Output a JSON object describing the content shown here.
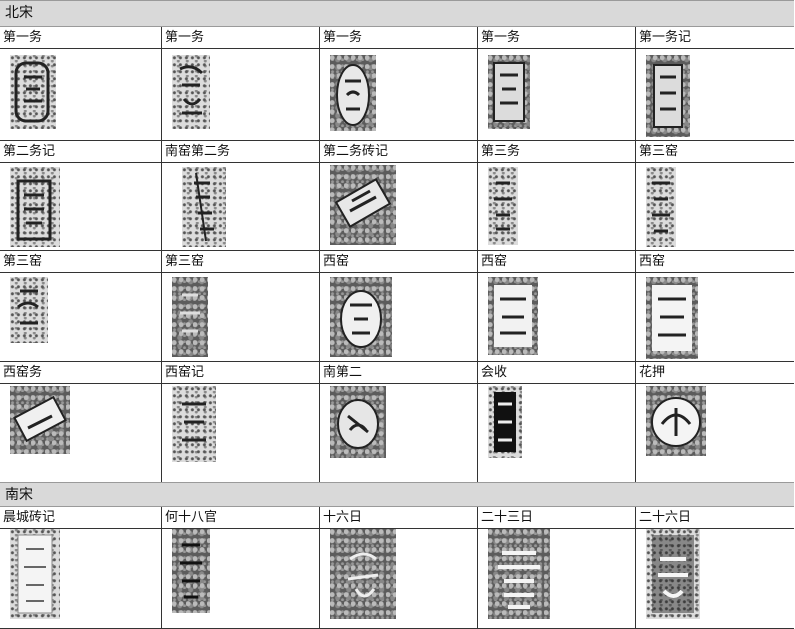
{
  "sections": [
    {
      "title": "北宋"
    },
    {
      "title": "南宋"
    }
  ],
  "north_song": {
    "rows": [
      [
        "第一务",
        "第一务",
        "第一务",
        "第一务",
        "第一务记"
      ],
      [
        "第二务记",
        "南窑第二务",
        "第二务砖记",
        "第三务",
        "第三窑"
      ],
      [
        "第三窑",
        "第三窑",
        "西窑",
        "西窑",
        "西窑"
      ],
      [
        "西窑务",
        "西窑记",
        "南第二",
        "会收",
        "花押"
      ]
    ]
  },
  "south_song": {
    "rows": [
      [
        "晨城砖记",
        "何十八官",
        "十六日",
        "二十三日",
        "二十六日"
      ]
    ]
  }
}
